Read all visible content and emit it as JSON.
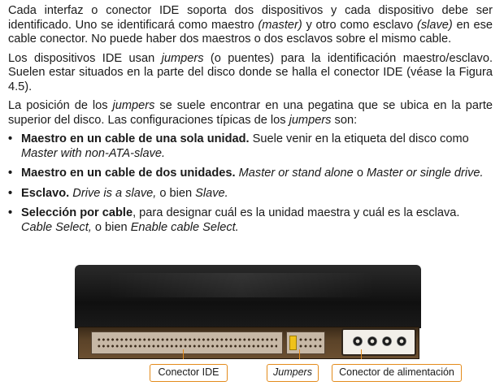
{
  "paragraphs": [
    {
      "segments": [
        {
          "t": "Cada interfaz o conector IDE soporta dos dispositivos y cada dispositivo debe ser identificado. Uno se identificará como maestro ",
          "s": ""
        },
        {
          "t": "(master)",
          "s": "i"
        },
        {
          "t": " y otro como esclavo ",
          "s": ""
        },
        {
          "t": "(slave)",
          "s": "i"
        },
        {
          "t": " en ese cable conector. No puede haber dos maestros o dos esclavos sobre el mismo cable.",
          "s": ""
        }
      ]
    },
    {
      "segments": [
        {
          "t": "Los dispositivos IDE usan ",
          "s": ""
        },
        {
          "t": "jumpers",
          "s": "i"
        },
        {
          "t": " (o puentes) para la identificación maestro/esclavo. Suelen estar situados en la parte del disco donde se halla el conector IDE (véase la Figura 4.5).",
          "s": ""
        }
      ]
    },
    {
      "segments": [
        {
          "t": "La posición de los ",
          "s": ""
        },
        {
          "t": "jumpers",
          "s": "i"
        },
        {
          "t": " se suele encontrar en una pegatina que se ubica en la parte superior del disco. Las configuraciones típicas de los ",
          "s": ""
        },
        {
          "t": "jumpers",
          "s": "i"
        },
        {
          "t": " son:",
          "s": ""
        }
      ]
    }
  ],
  "bullets": [
    {
      "segments": [
        {
          "t": "Maestro en un cable de una sola unidad.",
          "s": "b"
        },
        {
          "t": " Suele venir en la etiqueta del disco como ",
          "s": ""
        },
        {
          "t": "Master with non-ATA-slave.",
          "s": "i"
        }
      ]
    },
    {
      "segments": [
        {
          "t": "Maestro en un cable de dos unidades.",
          "s": "b"
        },
        {
          "t": " ",
          "s": ""
        },
        {
          "t": "Master or stand alone",
          "s": "i"
        },
        {
          "t": " o ",
          "s": ""
        },
        {
          "t": "Master or single drive.",
          "s": "i"
        }
      ]
    },
    {
      "segments": [
        {
          "t": "Esclavo.",
          "s": "b"
        },
        {
          "t": " ",
          "s": ""
        },
        {
          "t": "Drive is a slave,",
          "s": "i"
        },
        {
          "t": " o bien ",
          "s": ""
        },
        {
          "t": "Slave.",
          "s": "i"
        }
      ]
    },
    {
      "segments": [
        {
          "t": "Selección por cable",
          "s": "b"
        },
        {
          "t": ", para designar cuál es la unidad maestra y cuál es la esclava. ",
          "s": ""
        },
        {
          "t": "Cable Select,",
          "s": "i"
        },
        {
          "t": " o bien ",
          "s": ""
        },
        {
          "t": "Enable cable Select.",
          "s": "i"
        }
      ]
    }
  ],
  "bullet_glyph": "•",
  "figure": {
    "labels": {
      "ide": "Conector IDE",
      "jumpers": "Jumpers",
      "power": "Conector de alimentación"
    },
    "accent_color": "#e38b1b",
    "jumper_color": "#f0c21a"
  }
}
